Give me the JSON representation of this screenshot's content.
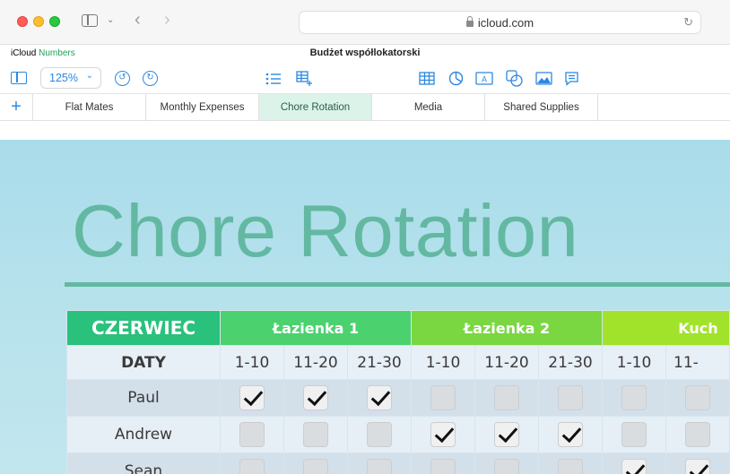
{
  "browser": {
    "url": "icloud.com"
  },
  "app": {
    "brand_icloud": "iCloud",
    "brand_app": "Numbers",
    "document_title": "Budżet współlokatorski",
    "zoom": "125%"
  },
  "sheets": [
    {
      "label": "Flat Mates",
      "active": false
    },
    {
      "label": "Monthly Expenses",
      "active": false
    },
    {
      "label": "Chore Rotation",
      "active": true
    },
    {
      "label": "Media",
      "active": false
    },
    {
      "label": "Shared Supplies",
      "active": false
    }
  ],
  "canvas": {
    "title": "Chore Rotation"
  },
  "table": {
    "month": "CZERWIEC",
    "groups": [
      "Łazienka 1",
      "Łazienka 2",
      "Kuch"
    ],
    "dates_label": "DATY",
    "date_ranges": [
      "1-10",
      "11-20",
      "21-30",
      "1-10",
      "11-20",
      "21-30",
      "1-10",
      "11-"
    ],
    "rows": [
      {
        "name": "Paul",
        "checks": [
          true,
          true,
          true,
          false,
          false,
          false,
          false,
          false
        ]
      },
      {
        "name": "Andrew",
        "checks": [
          false,
          false,
          false,
          true,
          true,
          true,
          false,
          false
        ]
      },
      {
        "name": "Sean",
        "checks": [
          false,
          false,
          false,
          false,
          false,
          false,
          true,
          true
        ]
      }
    ]
  },
  "colors": {
    "accent": "#2c88e0",
    "title": "#63b8a2",
    "month_header": "#29c17c",
    "group1": "#4cd16f",
    "group2": "#7ad742",
    "group3": "#a1e32a",
    "active_tab": "#dcf3ea"
  },
  "icons": {
    "browser": [
      "sidebar-icon",
      "chevron-down-icon",
      "back-icon",
      "forward-icon",
      "lock-icon",
      "reload-icon"
    ],
    "toolbar": [
      "panel-icon",
      "undo-icon",
      "redo-icon",
      "list-icon",
      "table-add-icon",
      "table-icon",
      "chart-icon",
      "text-box-icon",
      "shapes-icon",
      "media-icon",
      "comment-icon"
    ]
  }
}
